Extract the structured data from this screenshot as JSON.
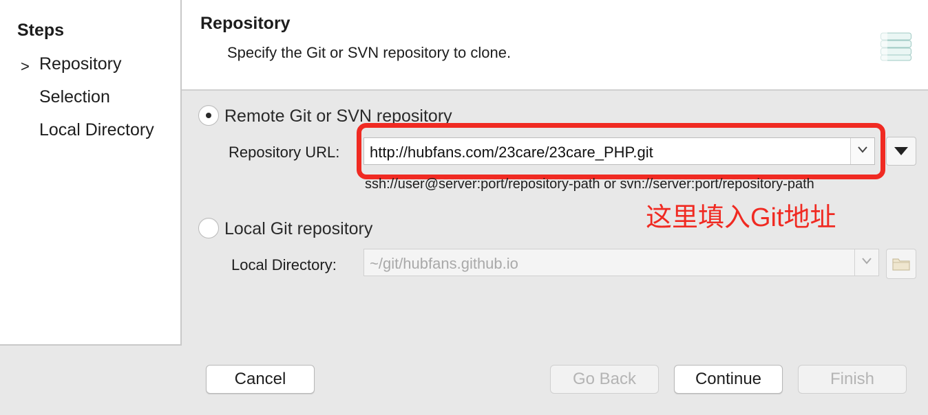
{
  "sidebar": {
    "title": "Steps",
    "items": [
      {
        "label": "Repository",
        "current": true
      },
      {
        "label": "Selection",
        "current": false
      },
      {
        "label": "Local Directory",
        "current": false
      }
    ],
    "current_marker": ">"
  },
  "header": {
    "title": "Repository",
    "description": "Specify the Git or SVN repository to clone.",
    "icon": "repository-stack-icon"
  },
  "remote": {
    "label": "Remote Git or SVN repository",
    "selected": true,
    "url_label": "Repository URL:",
    "url_value": "http://hubfans.com/23care/23care_PHP.git",
    "hint": "ssh://user@server:port/repository-path or svn://server:port/repository-path"
  },
  "annotation": {
    "text": "这里填入Git地址",
    "color": "#f02a22"
  },
  "local": {
    "label": "Local Git repository",
    "selected": false,
    "dir_label": "Local Directory:",
    "dir_placeholder": "~/git/hubfans.github.io",
    "browse_icon": "folder-icon"
  },
  "buttons": {
    "cancel": "Cancel",
    "go_back": "Go Back",
    "continue": "Continue",
    "finish": "Finish"
  }
}
